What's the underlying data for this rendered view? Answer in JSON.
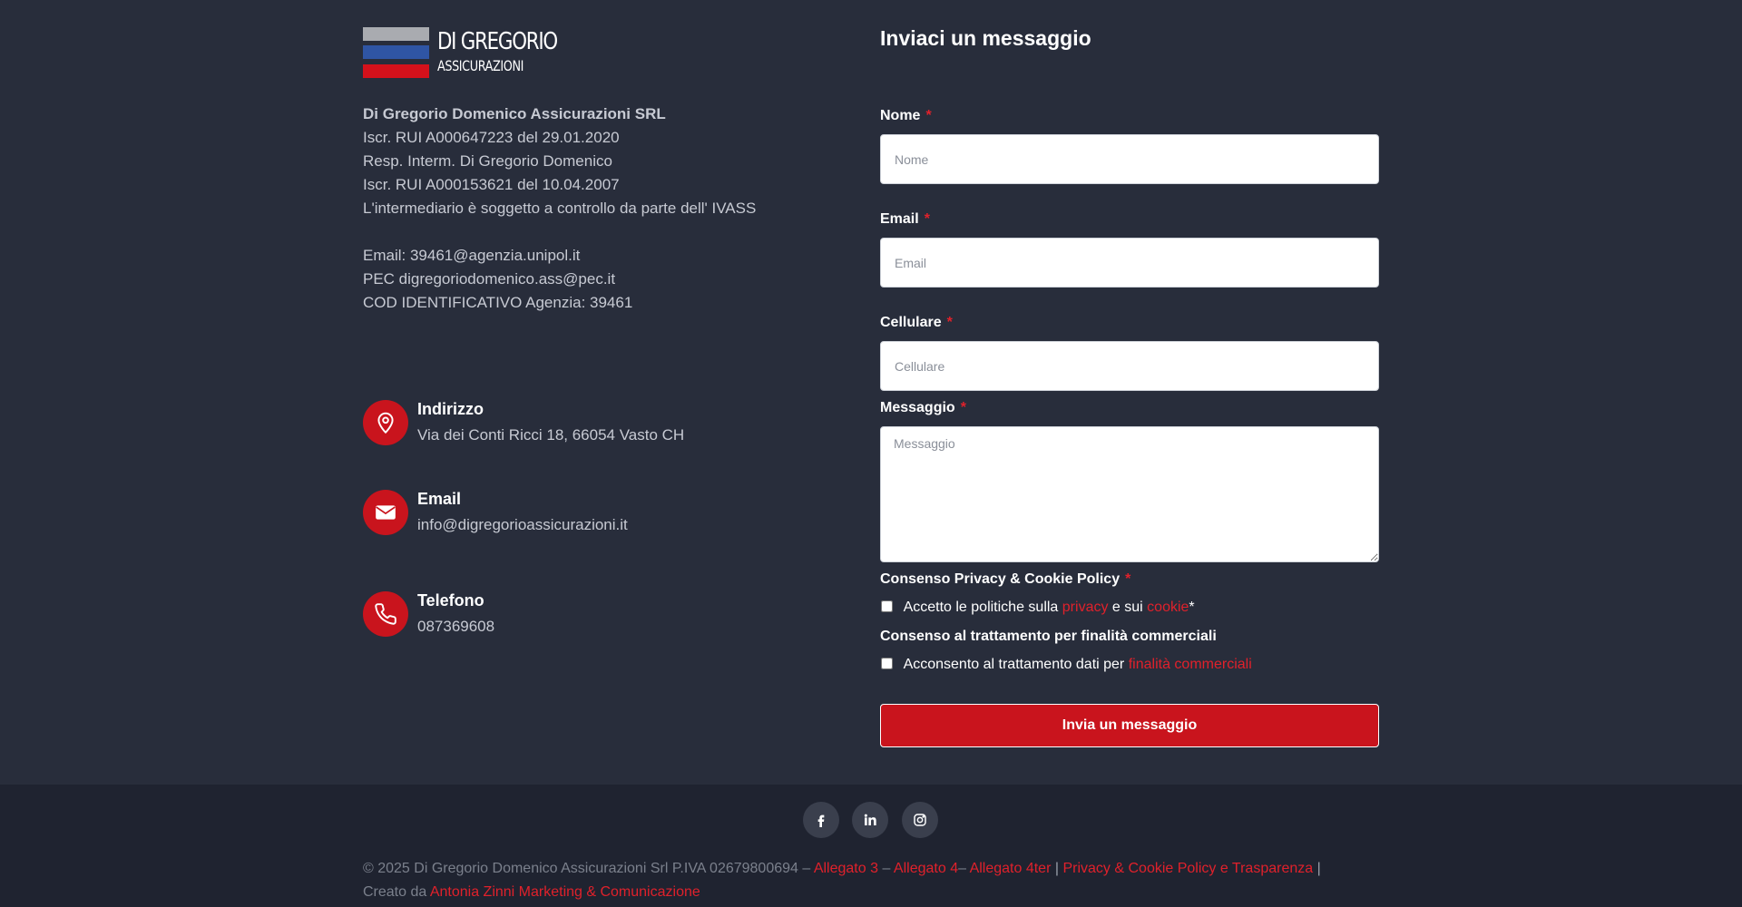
{
  "logo": {
    "name": "DI GREGORIO",
    "sub": "ASSICURAZIONI"
  },
  "company": {
    "name": "Di Gregorio Domenico Assicurazioni SRL",
    "lines": [
      "Iscr. RUI A000647223 del 29.01.2020",
      "Resp. Interm. Di Gregorio Domenico",
      "Iscr. RUI A000153621 del 10.04.2007",
      "L'intermediario è soggetto a controllo da parte dell' IVASS"
    ],
    "contact_lines": [
      "Email: 39461@agenzia.unipol.it",
      "PEC digregoriodomenico.ass@pec.it",
      "COD IDENTIFICATIVO Agenzia: 39461"
    ]
  },
  "contacts": [
    {
      "icon": "map-pin-icon",
      "title": "Indirizzo",
      "value": "Via dei Conti Ricci 18, 66054 Vasto CH"
    },
    {
      "icon": "envelope-icon",
      "title": "Email",
      "value": "info@digregorioassicurazioni.it"
    },
    {
      "icon": "phone-icon",
      "title": "Telefono",
      "value": "087369608"
    }
  ],
  "form": {
    "title": "Inviaci un messaggio",
    "required_mark": "*",
    "fields": {
      "nome": {
        "label": "Nome",
        "placeholder": "Nome",
        "value": ""
      },
      "email": {
        "label": "Email",
        "placeholder": "Email",
        "value": ""
      },
      "cellulare": {
        "label": "Cellulare",
        "placeholder": "Cellulare",
        "value": ""
      },
      "messaggio": {
        "label": "Messaggio",
        "placeholder": "Messaggio",
        "value": ""
      }
    },
    "privacy_consent": {
      "heading": "Consenso Privacy & Cookie Policy",
      "text_before": "Accetto le politiche sulla",
      "link_privacy": "privacy",
      "text_middle": "e sui",
      "link_cookie": "cookie",
      "required_mark": "*",
      "checked": false
    },
    "commercial_consent": {
      "heading": "Consenso al trattamento per finalità commerciali",
      "text_before": "Acconsento al trattamento dati per",
      "link": "finalità commerciali",
      "checked": false
    },
    "submit_label": "Invia un messaggio"
  },
  "footer": {
    "social": [
      "facebook-icon",
      "linkedin-icon",
      "instagram-icon"
    ],
    "copyright_text": "© 2025 Di Gregorio Domenico Assicurazioni Srl P.IVA 02679800694 –",
    "links": {
      "allegato3": "Allegato 3",
      "dash1": "–",
      "allegato4": "Allegato 4",
      "dash2": "–",
      "allegato4ter": "Allegato 4ter",
      "pipe1": "|",
      "privacy": "Privacy & Cookie Policy e Trasparenza",
      "pipe2": "|",
      "created_by": "Creato da",
      "agency": "Antonia Zinni Marketing & Comunicazione"
    }
  },
  "colors": {
    "background": "#282d3b",
    "footer_background": "#1f2330",
    "accent_red": "#c9141d",
    "link_red": "#e0212b"
  }
}
